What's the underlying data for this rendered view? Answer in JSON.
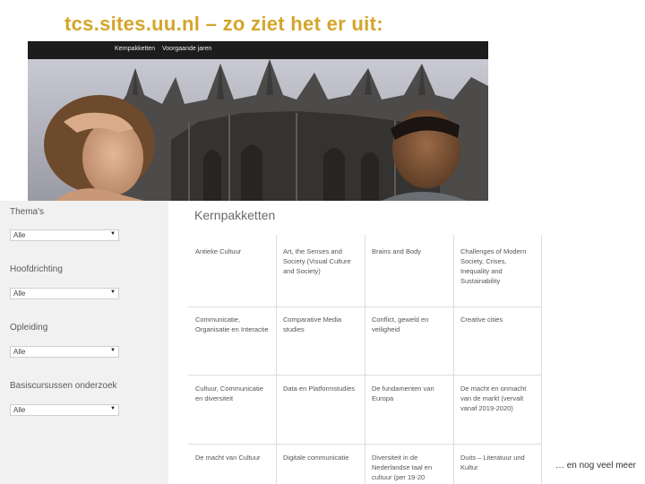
{
  "slide": {
    "title": "tcs.sites.uu.nl – zo ziet het er uit:",
    "footer_note": "… en nog veel meer"
  },
  "navbar": {
    "items": [
      "Kernpakketten",
      "Voorgaande jaren"
    ]
  },
  "sidebar": {
    "filters": [
      {
        "label": "Thema's",
        "value": "Alle"
      },
      {
        "label": "Hoofdrichting",
        "value": "Alle"
      },
      {
        "label": "Opleiding",
        "value": "Alle"
      },
      {
        "label": "Basiscursussen onderzoek",
        "value": "Alle"
      }
    ]
  },
  "content": {
    "title": "Kernpakketten",
    "grid": [
      [
        "Antieke Cultuur",
        "Art, the Senses and Society (Visual Culture and Society)",
        "Brains and Body",
        "Challenges of Modern Society, Crises, Inequality and Sustainability"
      ],
      [
        "Communicatie, Organisatie en Interactie",
        "Comparative Media studies",
        "Conflict, geweld en veiligheid",
        "Creative cities"
      ],
      [
        "Cultuur, Communicatie en diversiteit",
        "Data en Platformstudies",
        "De fundamenten van Europa",
        "De macht en onmacht van de markt (vervalt vanaf 2019-2020)"
      ],
      [
        "De macht van Cultuur",
        "Digitale communicatie",
        "Diversiteit in de Nederlandse taal en cultuur (per 19-20",
        "Duits – Literatuur und Kultur"
      ]
    ]
  },
  "colors": {
    "title_accent": "#d4a52b",
    "navbar_bg": "#1c1c1c",
    "sidebar_bg": "#f1f1f1"
  }
}
